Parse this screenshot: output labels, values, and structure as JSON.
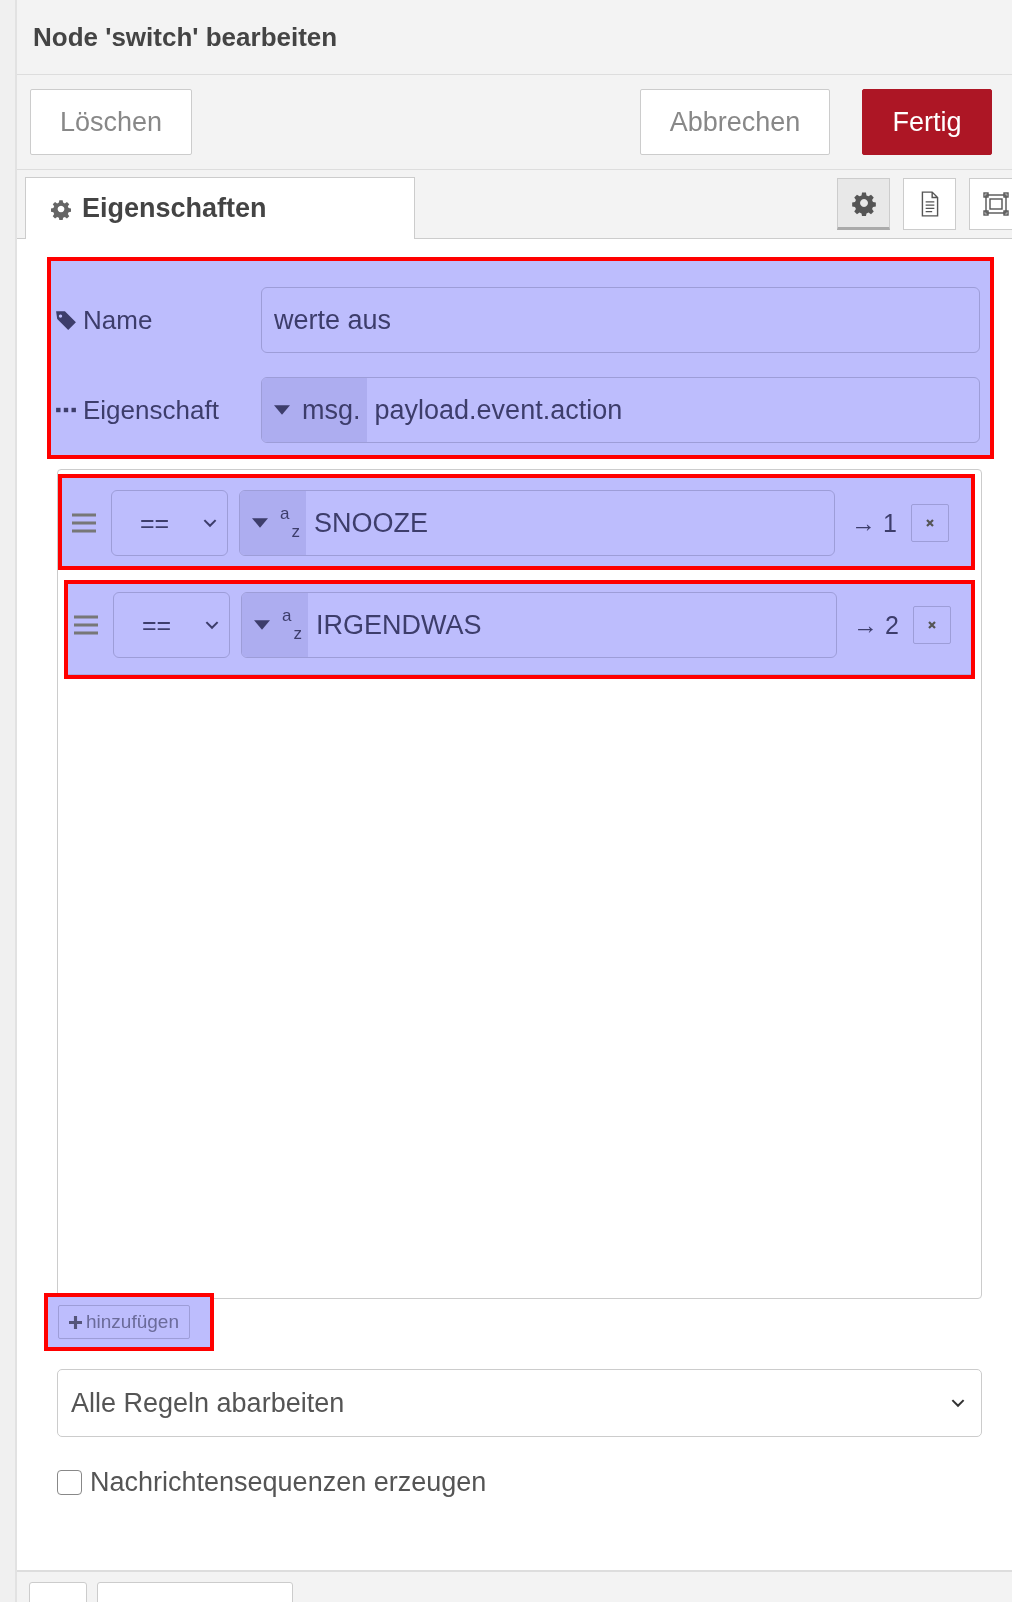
{
  "dialog": {
    "title": "Node 'switch' bearbeiten"
  },
  "actions": [
    {
      "kind": "delete",
      "label": "Löschen"
    },
    {
      "kind": "cancel",
      "label": "Abbrechen"
    },
    {
      "kind": "primary",
      "label": "Fertig"
    }
  ],
  "tabs": [
    {
      "label": "Eigenschaften",
      "selected": true
    }
  ],
  "side_tabs": [
    {
      "kind": "gear",
      "selected": true
    },
    {
      "kind": "document",
      "selected": false
    },
    {
      "kind": "frame",
      "selected": false
    }
  ],
  "properties": {
    "highlighted": true,
    "name": {
      "label": "Name",
      "value": "werte aus"
    },
    "property": {
      "label": "Eigenschaft",
      "prefix": "msg.",
      "value": "payload.event.action"
    }
  },
  "rules": [
    {
      "highlighted": true,
      "operator": "==",
      "type_top": "a",
      "type_bottom": "z",
      "value": "SNOOZE",
      "output": "→ 1"
    },
    {
      "highlighted": true,
      "operator": "==",
      "type_top": "a",
      "type_bottom": "z",
      "value": "IRGENDWAS",
      "output": "→ 2"
    }
  ],
  "add_button": {
    "label": "hinzufügen",
    "highlighted": true
  },
  "mode_select": {
    "value": "Alle Regeln abarbeiten"
  },
  "sequence_checkbox": {
    "label": "Nachrichtensequenzen erzeugen",
    "checked": false
  },
  "footer_buttons": [
    {
      "kind": "narrow"
    },
    {
      "kind": "wide"
    }
  ]
}
